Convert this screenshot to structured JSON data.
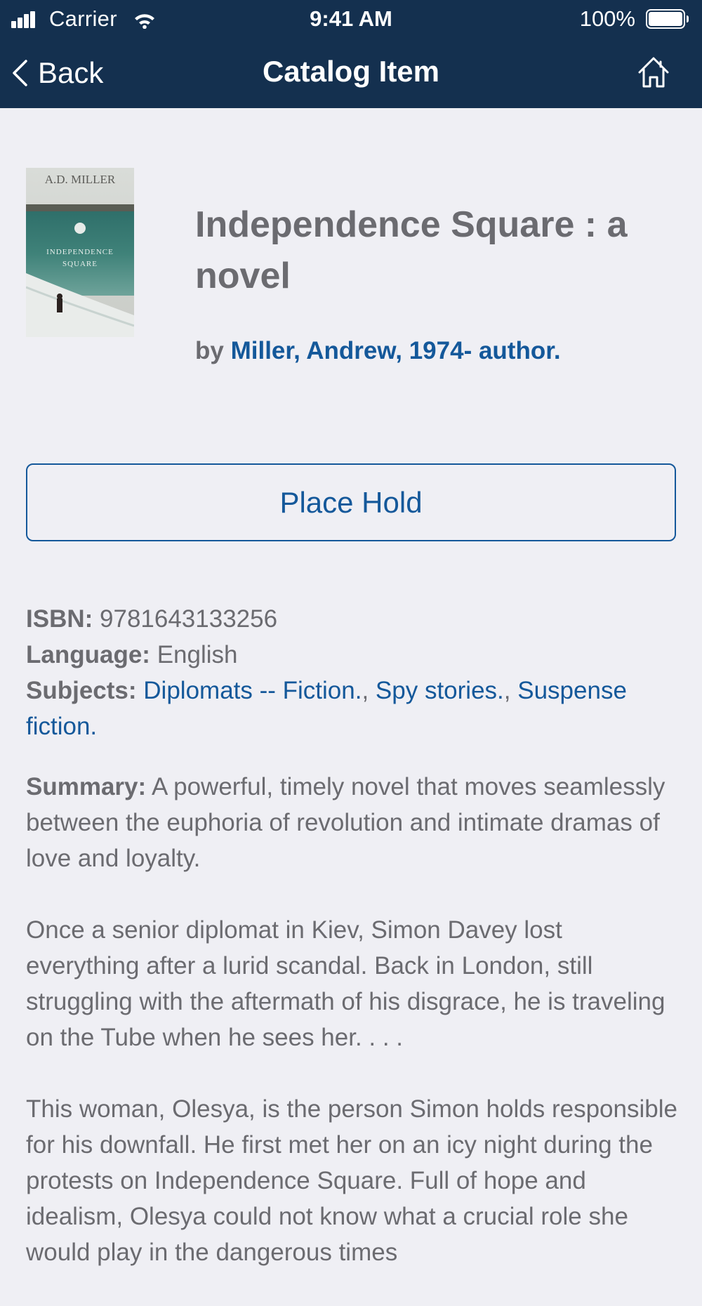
{
  "status_bar": {
    "carrier": "Carrier",
    "time": "9:41 AM",
    "battery": "100%"
  },
  "nav": {
    "back_label": "Back",
    "title": "Catalog Item",
    "home_icon": "home-icon"
  },
  "item": {
    "cover": {
      "author_text": "A.D. MILLER",
      "title_line1": "INDEPENDENCE",
      "title_line2": "SQUARE"
    },
    "title": "Independence Square : a novel",
    "by_label": "by",
    "author": "Miller, Andrew, 1974- author."
  },
  "actions": {
    "place_hold": "Place Hold"
  },
  "details": {
    "isbn_label": "ISBN:",
    "isbn": "9781643133256",
    "language_label": "Language:",
    "language": "English",
    "subjects_label": "Subjects:",
    "subjects": [
      "Diplomats -- Fiction.",
      "Spy stories.",
      "Suspense fiction."
    ],
    "separator": ","
  },
  "summary": {
    "label": "Summary:",
    "paragraphs": [
      "A powerful, timely novel that moves seamlessly between the euphoria of revolution and intimate dramas of love and loyalty.",
      "Once a senior diplomat in Kiev, Simon Davey lost everything after a lurid scandal. Back in London, still struggling with the aftermath of his disgrace, he is traveling on the Tube when he sees her. . . .",
      "This woman, Olesya, is the person Simon holds responsible for his downfall. He first met her on an icy night during the protests on Independence Square. Full of hope and idealism, Olesya could not know what a crucial role she would play in the dangerous times"
    ]
  },
  "colors": {
    "nav_bg": "#14304f",
    "page_bg": "#efeff4",
    "link": "#14589a",
    "text": "#6b6b70"
  }
}
